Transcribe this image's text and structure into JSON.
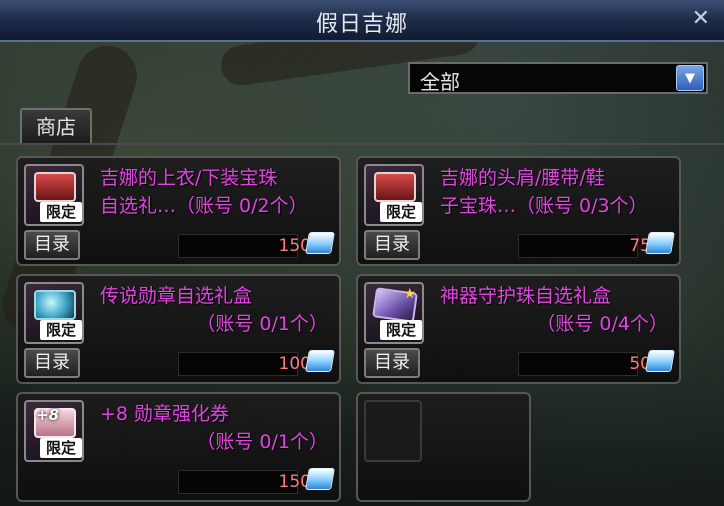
{
  "window": {
    "title": "假日吉娜",
    "close_symbol": "✕"
  },
  "filter": {
    "selected": "全部",
    "arrow_symbol": "▼"
  },
  "tabs": [
    {
      "label": "商店"
    }
  ],
  "items": [
    {
      "name_line1": "吉娜的上衣/下装宝珠",
      "name_line2": "自选礼…（账号 0/2个）",
      "badge": "限定",
      "icon": "gift-box-icon",
      "category_label": "目录",
      "price": "150",
      "currency_icon": "cera-coin-icon"
    },
    {
      "name_line1": "吉娜的头肩/腰带/鞋",
      "name_line2": "子宝珠…（账号 0/3个）",
      "badge": "限定",
      "icon": "gift-box-icon",
      "category_label": "目录",
      "price": "75",
      "currency_icon": "cera-coin-icon"
    },
    {
      "name_line1": "传说勋章自选礼盒",
      "name_line2": "（账号 0/1个）",
      "badge": "限定",
      "icon": "medal-swirl-icon",
      "category_label": "目录",
      "price": "100",
      "currency_icon": "cera-coin-icon"
    },
    {
      "name_line1": "神器守护珠自选礼盒",
      "name_line2": "（账号 0/4个）",
      "badge": "限定",
      "icon": "crystal-box-icon",
      "category_label": "目录",
      "price": "50",
      "currency_icon": "cera-coin-icon"
    },
    {
      "name_line1": "+8 勋章强化券",
      "name_line2": "（账号 0/1个）",
      "badge": "限定",
      "icon_text": "+8",
      "icon": "upgrade-ticket-icon",
      "category_label": "目录",
      "price": "150",
      "currency_icon": "cera-coin-icon"
    }
  ],
  "colors": {
    "item_name": "#e244e2",
    "price": "#ff7a7a",
    "title_bar": "#1f2e4d"
  }
}
